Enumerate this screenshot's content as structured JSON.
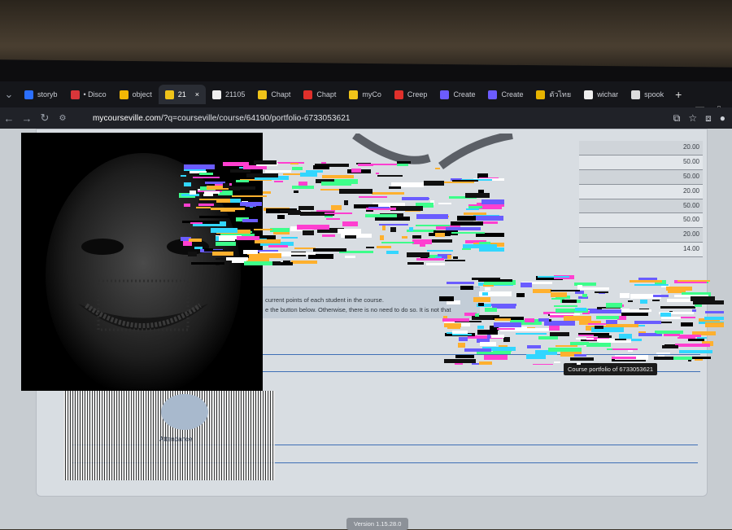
{
  "browser": {
    "tabs": [
      {
        "label": "storyb",
        "icon": "storybook-icon",
        "color": "#2b6fff"
      },
      {
        "label": "• Disco",
        "icon": "discord-icon",
        "color": "#d9363a"
      },
      {
        "label": "object",
        "icon": "drive-icon",
        "color": "#f2b705"
      },
      {
        "label": "21",
        "icon": "cv-icon",
        "color": "#f0c419",
        "active": true
      },
      {
        "label": "21105",
        "icon": "github-icon",
        "color": "#eeeeee"
      },
      {
        "label": "Chapt",
        "icon": "cv-icon",
        "color": "#f0c419"
      },
      {
        "label": "Chapt",
        "icon": "pdf-icon",
        "color": "#e0302b"
      },
      {
        "label": "myCo",
        "icon": "cv-icon",
        "color": "#f0c419"
      },
      {
        "label": "Creep",
        "icon": "creep-icon",
        "color": "#e0302b"
      },
      {
        "label": "Create",
        "icon": "create-icon",
        "color": "#6c5cff"
      },
      {
        "label": "Create",
        "icon": "create-icon",
        "color": "#6c5cff"
      },
      {
        "label": "ตัวไทย",
        "icon": "thai-icon",
        "color": "#e7b400"
      },
      {
        "label": "wichar",
        "icon": "github-icon",
        "color": "#eeeeee"
      },
      {
        "label": "spook",
        "icon": "google-icon",
        "color": "#dddddd"
      }
    ],
    "active_close": "×",
    "new_tab": "+",
    "url_host": "mycourseville.com",
    "url_path": "/?q=courseville/course/64190/portfolio-6733053621"
  },
  "scores": [
    "20.00",
    "50.00",
    "50.00",
    "20.00",
    "50.00",
    "50.00",
    "20.00",
    "14.00"
  ],
  "info": {
    "line1": "current points of each student in the course.",
    "line2": "e the button below. Otherwise, there is no need to do so. It is not that"
  },
  "tooltip": "Course portfolio of 6733053621",
  "attendance_label": "Attendance",
  "version": "Version 1.15.28.0",
  "colors": {
    "accent": "#3f6fb6",
    "page_bg": "#d8dde2"
  }
}
